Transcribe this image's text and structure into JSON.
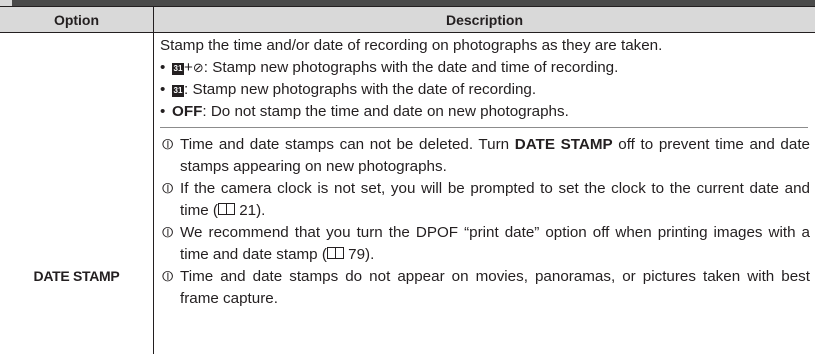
{
  "table": {
    "header_option": "Option",
    "header_description": "Description",
    "option_name": "DATE STAMP"
  },
  "description": {
    "intro": "Stamp the time and/or date of recording on photographs as they are taken.",
    "bullet1_text": ": Stamp new photographs with the date and time of recording.",
    "bullet2_text": ": Stamp new photographs with the date of recording.",
    "bullet3_label": "OFF",
    "bullet3_text": ": Do not stamp the time and date on new photographs."
  },
  "notes": {
    "n1_pre": "Time and date stamps can not be deleted. Turn ",
    "n1_bold": "DATE STAMP",
    "n1_post": " off to prevent time and date stamps appearing on new photographs.",
    "n2_pre": "If the camera clock is not set, you will be prompted to set the clock to the current date and time (",
    "n2_page": "21",
    "n2_post": ").",
    "n3_pre": "We recommend that you turn the DPOF “print date” option off when printing images with a time and date stamp (",
    "n3_page": "79",
    "n3_post": ").",
    "n4": "Time and date stamps do not appear on movies, panoramas, or pictures taken with best frame capture."
  },
  "icons": {
    "calendar": "calendar-icon",
    "clock": "clock-icon",
    "warning": "caution-icon",
    "page_ref": "book-icon"
  }
}
